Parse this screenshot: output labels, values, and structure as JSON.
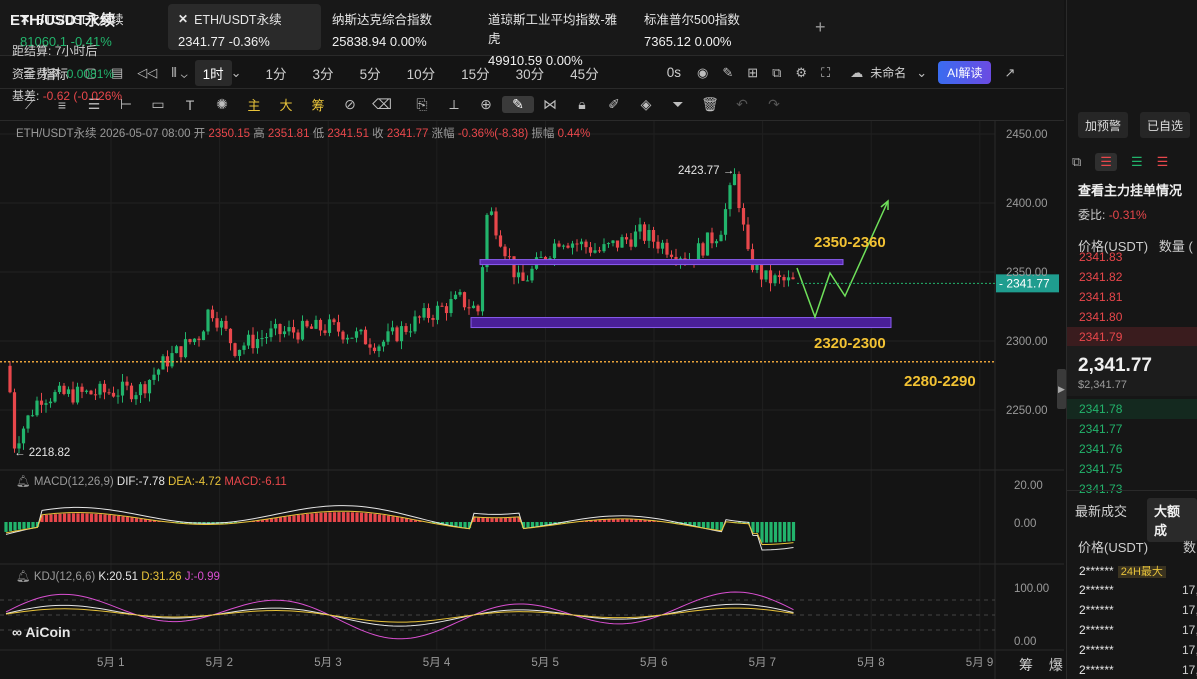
{
  "tickers": [
    {
      "name": "BTC/USDT永续",
      "price": "81060.1",
      "change": "-0.41%",
      "price_color": "#22b46c",
      "active": false
    },
    {
      "name": "ETH/USDT永续",
      "price": "2341.77",
      "change": "-0.36%",
      "price_color": "#f0f0f0",
      "active": true
    },
    {
      "name": "纳斯达克综合指数",
      "price": "25838.94",
      "change": "0.00%"
    },
    {
      "name": "道琼斯工业平均指数-雅虎",
      "price": "49910.59",
      "change": "0.00%"
    },
    {
      "name": "标准普尔500指数",
      "price": "7365.12",
      "change": "0.00%"
    }
  ],
  "toolbar": {
    "indicators_label": "指标",
    "intervals": [
      "1时",
      "1分",
      "3分",
      "5分",
      "10分",
      "15分",
      "30分",
      "45分"
    ],
    "selected_interval": "1时",
    "countdown": "0s",
    "layout_name": "未命名",
    "ai_label": "AI解读"
  },
  "drawbar": {
    "yellow_tools": [
      "主",
      "大",
      "筹"
    ]
  },
  "legend": {
    "symbol": "ETH/USDT永续",
    "datetime": "2026-05-07 08:00",
    "open_label": "开",
    "open": "2350.15",
    "high_label": "高",
    "high": "2351.81",
    "low_label": "低",
    "low": "2341.51",
    "close_label": "收",
    "close": "2341.77",
    "chg_label": "涨幅",
    "chg": "-0.36%(-8.38)",
    "amp_label": "振幅",
    "amp": "0.44%"
  },
  "chart_data": {
    "type": "candlestick",
    "y_ticks": [
      "2450.00",
      "2400.00",
      "2350.00",
      "2300.00",
      "2250.00"
    ],
    "x_ticks": [
      "5月 1",
      "5月 2",
      "5月 3",
      "5月 4",
      "5月 5",
      "5月 6",
      "5月 7",
      "5月 8",
      "5月 9"
    ],
    "last_price": "2341.77",
    "high_marker": "2423.77",
    "low_marker": "2218.82",
    "zones": [
      "2350-2360",
      "2320-2300",
      "2280-2290"
    ],
    "macd": {
      "label": "MACD(12,26,9)",
      "dif": "DIF:-7.78",
      "dea": "DEA:-4.72",
      "macd": "MACD:-6.11",
      "y_ticks": [
        "20.00",
        "0.00"
      ]
    },
    "kdj": {
      "label": "KDJ(12,6,6)",
      "k": "K:20.51",
      "d": "D:31.26",
      "j": "J:-0.99",
      "y_ticks": [
        "100.00",
        "0.00"
      ]
    }
  },
  "sidebar": {
    "title": "ETH/USDT永续",
    "settle_label": "距结算:",
    "settle_value": "7小时后",
    "funding_label": "资金费率:",
    "funding_value": "0.0081%",
    "basis_label": "基差:",
    "basis_value": "-0.62 (-0.026%",
    "alert_btn": "加预警",
    "watch_btn": "已自选",
    "orderbook_title": "查看主力挂单情况",
    "ratio_label": "委比:",
    "ratio_value": "-0.31%",
    "price_col": "价格(USDT)",
    "qty_col": "数量 (",
    "asks": [
      "2341.83",
      "2341.82",
      "2341.81",
      "2341.80",
      "2341.79"
    ],
    "last_price": "2,341.77",
    "last_price_usd": "$2,341.77",
    "bids": [
      "2341.78",
      "2341.77",
      "2341.76",
      "2341.75",
      "2341.73"
    ],
    "trades_tab": "最新成交",
    "big_trades_tab": "大额成",
    "trades_price_col": "价格(USDT)",
    "trades_qty_col": "数",
    "trades": [
      {
        "price": "2******",
        "tag": "24H最大",
        "qty": ""
      },
      {
        "price": "2******",
        "qty": "17,"
      },
      {
        "price": "2******",
        "qty": "17,"
      },
      {
        "price": "2******",
        "qty": "17,"
      },
      {
        "price": "2******",
        "qty": "17,"
      },
      {
        "price": "2******",
        "qty": "17,"
      }
    ]
  },
  "footer": {
    "logo": "AiCoin",
    "chou": "筹 爆"
  }
}
